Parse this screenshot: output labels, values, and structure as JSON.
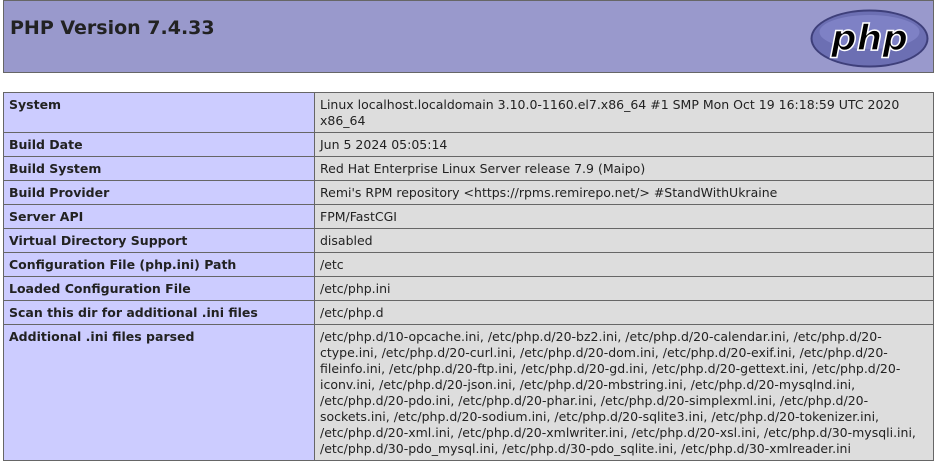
{
  "header": {
    "title": "PHP Version 7.4.33",
    "logo_text": "php"
  },
  "rows": [
    {
      "key": "System",
      "value": "Linux localhost.localdomain 3.10.0-1160.el7.x86_64 #1 SMP Mon Oct 19 16:18:59 UTC 2020 x86_64"
    },
    {
      "key": "Build Date",
      "value": "Jun 5 2024 05:05:14"
    },
    {
      "key": "Build System",
      "value": "Red Hat Enterprise Linux Server release 7.9 (Maipo)"
    },
    {
      "key": "Build Provider",
      "value": "Remi's RPM repository <https://rpms.remirepo.net/> #StandWithUkraine"
    },
    {
      "key": "Server API",
      "value": "FPM/FastCGI"
    },
    {
      "key": "Virtual Directory Support",
      "value": "disabled"
    },
    {
      "key": "Configuration File (php.ini) Path",
      "value": "/etc"
    },
    {
      "key": "Loaded Configuration File",
      "value": "/etc/php.ini"
    },
    {
      "key": "Scan this dir for additional .ini files",
      "value": "/etc/php.d"
    },
    {
      "key": "Additional .ini files parsed",
      "value": "/etc/php.d/10-opcache.ini, /etc/php.d/20-bz2.ini, /etc/php.d/20-calendar.ini, /etc/php.d/20-ctype.ini, /etc/php.d/20-curl.ini, /etc/php.d/20-dom.ini, /etc/php.d/20-exif.ini, /etc/php.d/20-fileinfo.ini, /etc/php.d/20-ftp.ini, /etc/php.d/20-gd.ini, /etc/php.d/20-gettext.ini, /etc/php.d/20-iconv.ini, /etc/php.d/20-json.ini, /etc/php.d/20-mbstring.ini, /etc/php.d/20-mysqlnd.ini, /etc/php.d/20-pdo.ini, /etc/php.d/20-phar.ini, /etc/php.d/20-simplexml.ini, /etc/php.d/20-sockets.ini, /etc/php.d/20-sodium.ini, /etc/php.d/20-sqlite3.ini, /etc/php.d/20-tokenizer.ini, /etc/php.d/20-xml.ini, /etc/php.d/20-xmlwriter.ini, /etc/php.d/20-xsl.ini, /etc/php.d/30-mysqli.ini, /etc/php.d/30-pdo_mysql.ini, /etc/php.d/30-pdo_sqlite.ini, /etc/php.d/30-xmlreader.ini"
    }
  ],
  "colors": {
    "header_bg": "#9999cc",
    "key_bg": "#ccccff",
    "value_bg": "#dddddd",
    "border": "#666666",
    "logo_fill": "#6c6fb3"
  }
}
